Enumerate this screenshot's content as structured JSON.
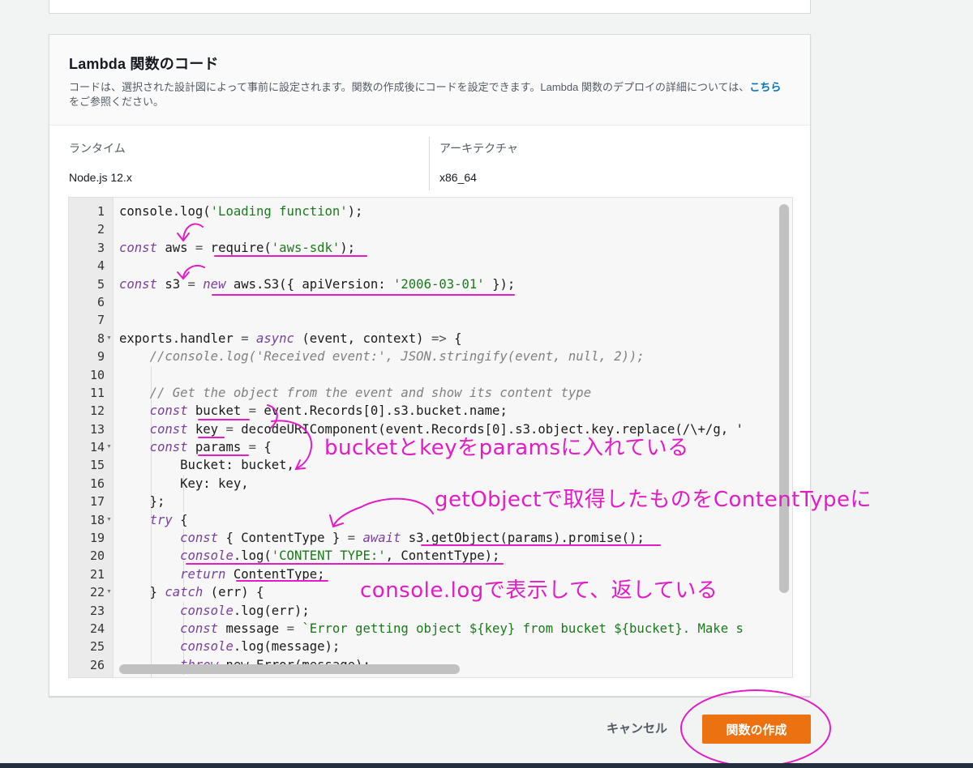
{
  "section": {
    "title": "Lambda 関数のコード",
    "desc_before_link": "コードは、選択された設計図によって事前に設定されます。関数の作成後にコードを設定できます。Lambda 関数のデプロイの詳細については、",
    "desc_link": "こちら",
    "desc_after_link": "をご参照ください。"
  },
  "runtime": {
    "label": "ランタイム",
    "value": "Node.js 12.x"
  },
  "architecture": {
    "label": "アーキテクチャ",
    "value": "x86_64"
  },
  "editor": {
    "line_numbers": [
      "1",
      "2",
      "3",
      "4",
      "5",
      "6",
      "7",
      "8",
      "9",
      "10",
      "11",
      "12",
      "13",
      "14",
      "15",
      "16",
      "17",
      "18",
      "19",
      "20",
      "21",
      "22",
      "23",
      "24",
      "25",
      "26"
    ],
    "fold_lines": [
      8,
      14,
      18,
      22
    ],
    "lines": [
      [
        [
          "",
          "console.log("
        ],
        [
          "s",
          "'Loading function'"
        ],
        [
          "",
          ");"
        ]
      ],
      [],
      [
        [
          "k",
          "const"
        ],
        [
          "",
          " aws "
        ],
        [
          "a",
          "="
        ],
        [
          "",
          " require("
        ],
        [
          "s",
          "'aws-sdk'"
        ],
        [
          "",
          ");"
        ]
      ],
      [],
      [
        [
          "k",
          "const"
        ],
        [
          "",
          " s3 "
        ],
        [
          "a",
          "="
        ],
        [
          "",
          " "
        ],
        [
          "k",
          "new"
        ],
        [
          "",
          " aws.S3({ apiVersion: "
        ],
        [
          "s",
          "'2006-03-01'"
        ],
        [
          "",
          " });"
        ]
      ],
      [],
      [],
      [
        [
          "",
          "exports.handler "
        ],
        [
          "a",
          "="
        ],
        [
          "",
          " "
        ],
        [
          "k",
          "async"
        ],
        [
          "",
          " (event, context) "
        ],
        [
          "a",
          "=>"
        ],
        [
          "",
          " {"
        ]
      ],
      [
        [
          "",
          "    "
        ],
        [
          "c",
          "//console.log('Received event:', JSON.stringify(event, null, 2));"
        ]
      ],
      [],
      [
        [
          "",
          "    "
        ],
        [
          "c",
          "// Get the object from the event and show its content type"
        ]
      ],
      [
        [
          "",
          "    "
        ],
        [
          "k",
          "const"
        ],
        [
          "",
          " bucket "
        ],
        [
          "a",
          "="
        ],
        [
          "",
          " event.Records[0].s3.bucket.name;"
        ]
      ],
      [
        [
          "",
          "    "
        ],
        [
          "k",
          "const"
        ],
        [
          "",
          " key "
        ],
        [
          "a",
          "="
        ],
        [
          "",
          " decodeURIComponent(event.Records[0].s3.object.key.replace(/\\+/g, '"
        ]
      ],
      [
        [
          "",
          "    "
        ],
        [
          "k",
          "const"
        ],
        [
          "",
          " params "
        ],
        [
          "a",
          "="
        ],
        [
          "",
          " {"
        ]
      ],
      [
        [
          "",
          "        Bucket: bucket,"
        ]
      ],
      [
        [
          "",
          "        Key: key,"
        ]
      ],
      [
        [
          "",
          "    };"
        ]
      ],
      [
        [
          "",
          "    "
        ],
        [
          "k",
          "try"
        ],
        [
          "",
          " {"
        ]
      ],
      [
        [
          "",
          "        "
        ],
        [
          "k",
          "const"
        ],
        [
          "",
          " { ContentType } "
        ],
        [
          "a",
          "="
        ],
        [
          "",
          " "
        ],
        [
          "k",
          "await"
        ],
        [
          "",
          " s3.getObject(params).promise();"
        ]
      ],
      [
        [
          "",
          "        "
        ],
        [
          "k",
          "console"
        ],
        [
          "",
          ".log("
        ],
        [
          "s",
          "'CONTENT TYPE:'"
        ],
        [
          "",
          ", ContentType);"
        ]
      ],
      [
        [
          "",
          "        "
        ],
        [
          "k",
          "return"
        ],
        [
          "",
          " ContentType;"
        ]
      ],
      [
        [
          "",
          "    } "
        ],
        [
          "k",
          "catch"
        ],
        [
          "",
          " (err) {"
        ]
      ],
      [
        [
          "",
          "        "
        ],
        [
          "k",
          "console"
        ],
        [
          "",
          ".log(err);"
        ]
      ],
      [
        [
          "",
          "        "
        ],
        [
          "k",
          "const"
        ],
        [
          "",
          " message "
        ],
        [
          "a",
          "="
        ],
        [
          "",
          " "
        ],
        [
          "s",
          "`Error getting object ${key} from bucket ${bucket}. Make s"
        ]
      ],
      [
        [
          "",
          "        "
        ],
        [
          "k",
          "console"
        ],
        [
          "",
          ".log(message);"
        ]
      ],
      [
        [
          "",
          "        "
        ],
        [
          "k",
          "throw"
        ],
        [
          "",
          " new Error(message);"
        ]
      ]
    ]
  },
  "annotations": {
    "note1": "bucketとkeyをparamsに入れている",
    "note2": "getObjectで取得したものをContentTypeに",
    "note3": "console.logで表示して、返している",
    "color": "#e31cc6"
  },
  "buttons": {
    "cancel": "キャンセル",
    "create": "関数の作成"
  },
  "colors": {
    "accent": "#ec7211",
    "link": "#0073bb"
  }
}
